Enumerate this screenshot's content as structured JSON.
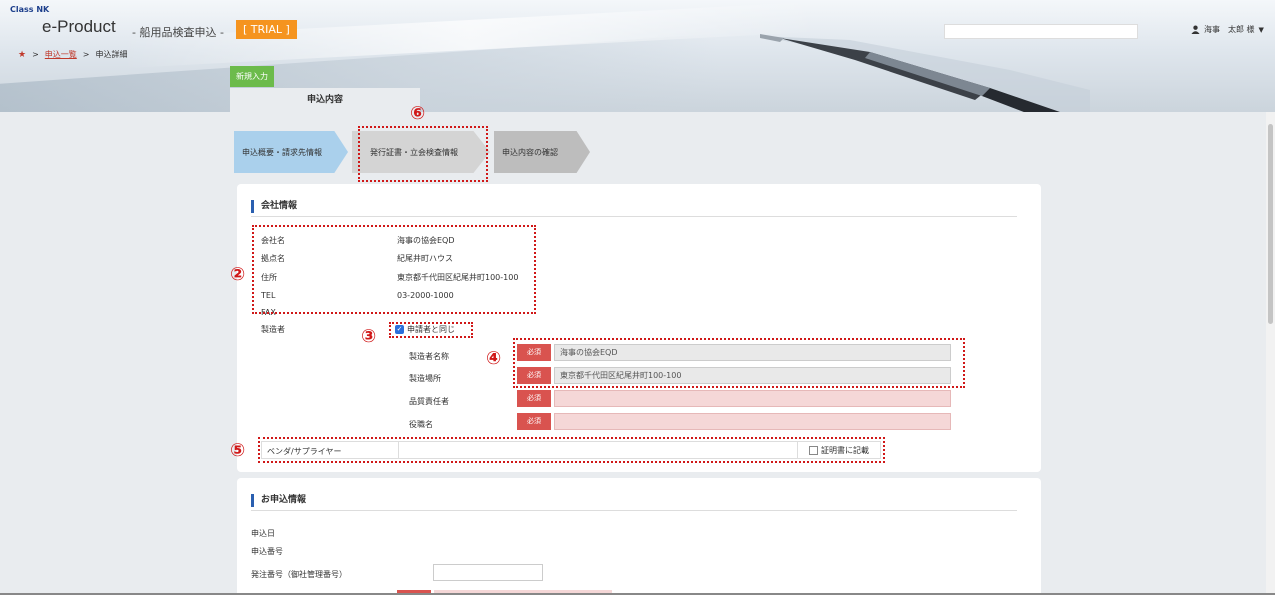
{
  "header": {
    "brand": "Class NK",
    "app_title": "e-Product",
    "app_subtitle": "- 船用品検査申込 -",
    "trial_badge": "[ TRIAL ]",
    "user_name": "海事　太郎 様",
    "breadcrumb": {
      "link": "申込一覧",
      "current": "申込詳細"
    },
    "new_entry_button": "新規入力",
    "active_tab": "申込内容"
  },
  "steps": [
    {
      "label": "申込概要・請求先情報"
    },
    {
      "label": "発行証書・立会検査情報"
    },
    {
      "label": "申込内容の確認"
    }
  ],
  "company": {
    "section_title": "会社情報",
    "rows": [
      {
        "label": "会社名",
        "value": "海事の協会EQD"
      },
      {
        "label": "拠点名",
        "value": "紀尾井町ハウス"
      },
      {
        "label": "住所",
        "value": "東京都千代田区紀尾井町100-100"
      },
      {
        "label": "TEL",
        "value": "03-2000-1000"
      },
      {
        "label": "FAX",
        "value": ""
      }
    ],
    "manufacturer_label": "製造者",
    "same_as_applicant": "申請者と同じ",
    "required": "必須",
    "mfr_fields": [
      {
        "label": "製造者名称",
        "value": "海事の協会EQD"
      },
      {
        "label": "製造場所",
        "value": "東京都千代田区紀尾井町100-100"
      },
      {
        "label": "品質責任者",
        "value": ""
      },
      {
        "label": "役職名",
        "value": ""
      }
    ],
    "vendor_label": "ベンダ/サプライヤー",
    "vendor_checkbox": "証明書に記載"
  },
  "application": {
    "section_title": "お申込情報",
    "rows": [
      {
        "label": "申込日"
      },
      {
        "label": "申込番号"
      },
      {
        "label": "発注番号（御社管理番号）"
      }
    ]
  },
  "annotations": [
    "②",
    "③",
    "④",
    "⑤",
    "⑥"
  ],
  "colors": {
    "required": "#d9534f",
    "annotation": "#d01818",
    "step_active": "#aad0ec",
    "trial": "#f5941f",
    "new_entry": "#6cbb4b"
  }
}
